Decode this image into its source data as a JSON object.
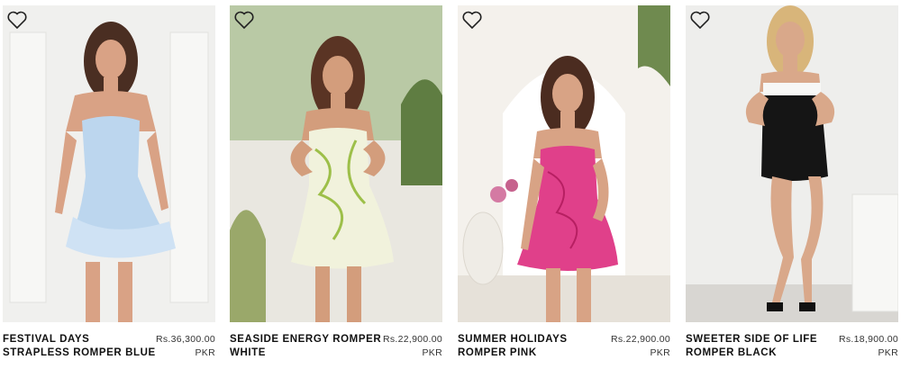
{
  "products": [
    {
      "name": "FESTIVAL DAYS STRAPLESS ROMPER BLUE",
      "price": "Rs.36,300.00",
      "currency": "PKR",
      "color": "#bcd6ee"
    },
    {
      "name": "SEASIDE ENERGY ROMPER WHITE",
      "price": "Rs.22,900.00",
      "currency": "PKR",
      "color": "#f1f2dc"
    },
    {
      "name": "SUMMER HOLIDAYS ROMPER PINK",
      "price": "Rs.22,900.00",
      "currency": "PKR",
      "color": "#e0408a"
    },
    {
      "name": "SWEETER SIDE OF LIFE ROMPER BLACK",
      "price": "Rs.18,900.00",
      "currency": "PKR",
      "color": "#151515"
    }
  ],
  "icons": {
    "wishlist": "heart-outline-icon"
  }
}
